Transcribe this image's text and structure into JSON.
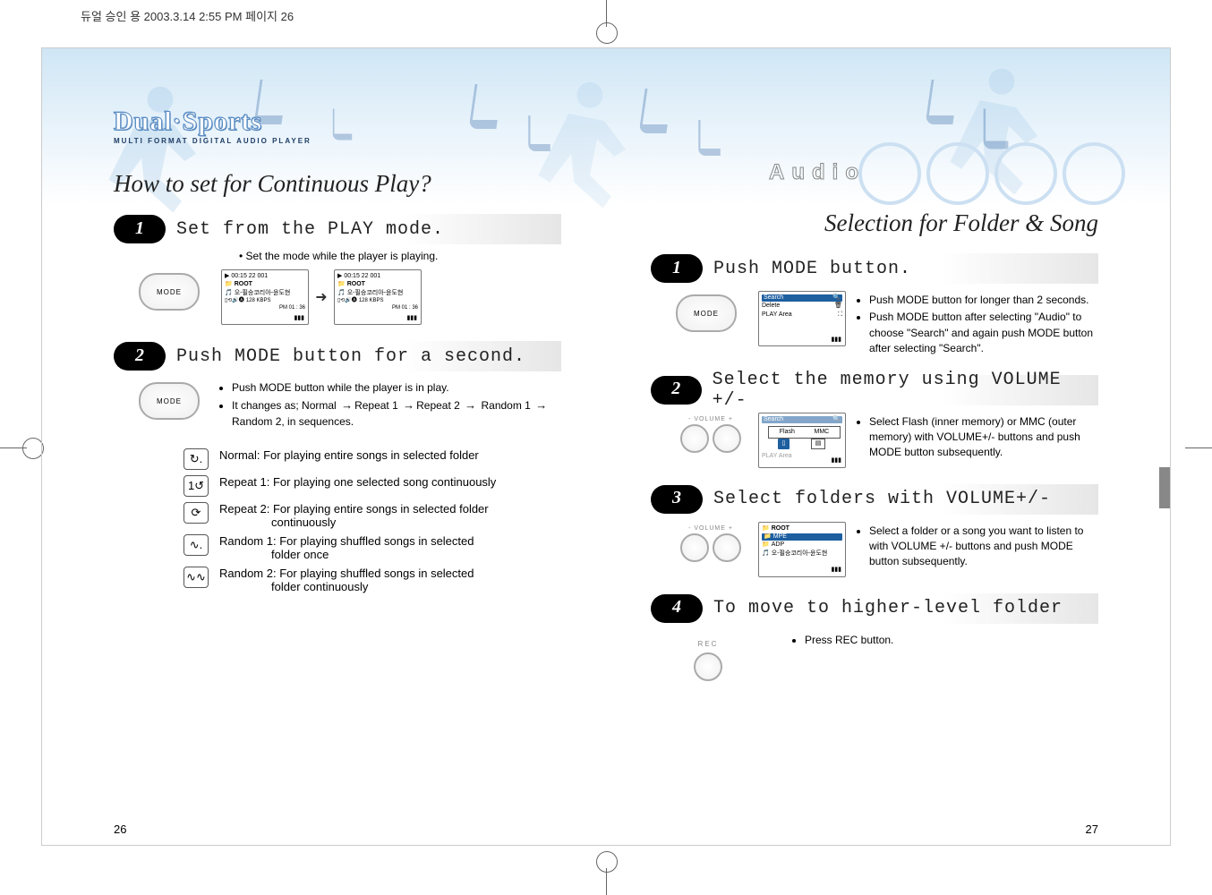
{
  "header_info": "듀얼 승인 용  2003.3.14 2:55 PM  페이지 26",
  "logo": {
    "main": "Dual·Sports",
    "sub": "MULTI FORMAT DIGITAL AUDIO PLAYER"
  },
  "audio_label": "Audio",
  "left": {
    "title": "How to set for Continuous Play?",
    "page_number": "26",
    "step1": {
      "num": "1",
      "title": "Set from the PLAY mode.",
      "tip": "Set the mode while the player is playing.",
      "btn_label": "MODE",
      "lcd1": {
        "time": "▶ 00:15  22  001",
        "root": "ROOT",
        "song": "오-필승코리아-윤도현",
        "bitrate": "128 KBPS",
        "clock": "PM 01 : 36"
      },
      "lcd2": {
        "time": "▶ 00:15  22  001",
        "root": "ROOT",
        "song": "오-필승코리아-윤도현",
        "bitrate": "128 KBPS",
        "clock": "PM 01 : 36"
      }
    },
    "step2": {
      "num": "2",
      "title": "Push MODE button for a second.",
      "btn_label": "MODE",
      "bullets": [
        "Push MODE button while the player is in play.",
        "It changes as; Normal → Repeat 1 → Repeat 2 → Random 1 → Random 2, in sequences."
      ],
      "modes": {
        "normal": "Normal: For playing entire songs in selected folder",
        "repeat1": "Repeat 1: For playing one selected song continuously",
        "repeat2_a": "Repeat 2: For playing entire songs in selected folder",
        "repeat2_b": "continuously",
        "random1_a": "Random 1: For playing shuffled songs in selected",
        "random1_b": "folder once",
        "random2_a": "Random 2: For playing shuffled songs in selected",
        "random2_b": "folder continuously"
      }
    }
  },
  "right": {
    "title": "Selection for Folder & Song",
    "page_number": "27",
    "step1": {
      "num": "1",
      "title": "Push MODE button.",
      "btn_label": "MODE",
      "lcd": {
        "search": "Search",
        "delete": "Delete",
        "play_area": "PLAY Area"
      },
      "bullets": [
        "Push MODE button for longer than 2 seconds.",
        "Push MODE button after selecting \"Audio\" to choose \"Search\" and again push MODE button after selecting \"Search\"."
      ]
    },
    "step2": {
      "num": "2",
      "title": "Select the memory using VOLUME +/-",
      "btn_label": "- VOLUME +",
      "lcd": {
        "search": "Search",
        "flash": "Flash",
        "mmc": "MMC",
        "play_area": "PLAY Area"
      },
      "bullet": "Select Flash (inner memory) or MMC (outer memory) with VOLUME+/- buttons and push MODE button subsequently."
    },
    "step3": {
      "num": "3",
      "title": "Select folders with VOLUME+/-",
      "btn_label": "- VOLUME +",
      "lcd": {
        "root": "ROOT",
        "mpe": "MPE",
        "adp": "ADP",
        "song": "오-필승코리아-윤도현"
      },
      "bullet": "Select a folder or a song you want to listen to with VOLUME +/- buttons and push MODE button subsequently."
    },
    "step4": {
      "num": "4",
      "title": "To move to higher-level folder",
      "btn_label": "REC",
      "bullet": "Press REC button."
    }
  }
}
